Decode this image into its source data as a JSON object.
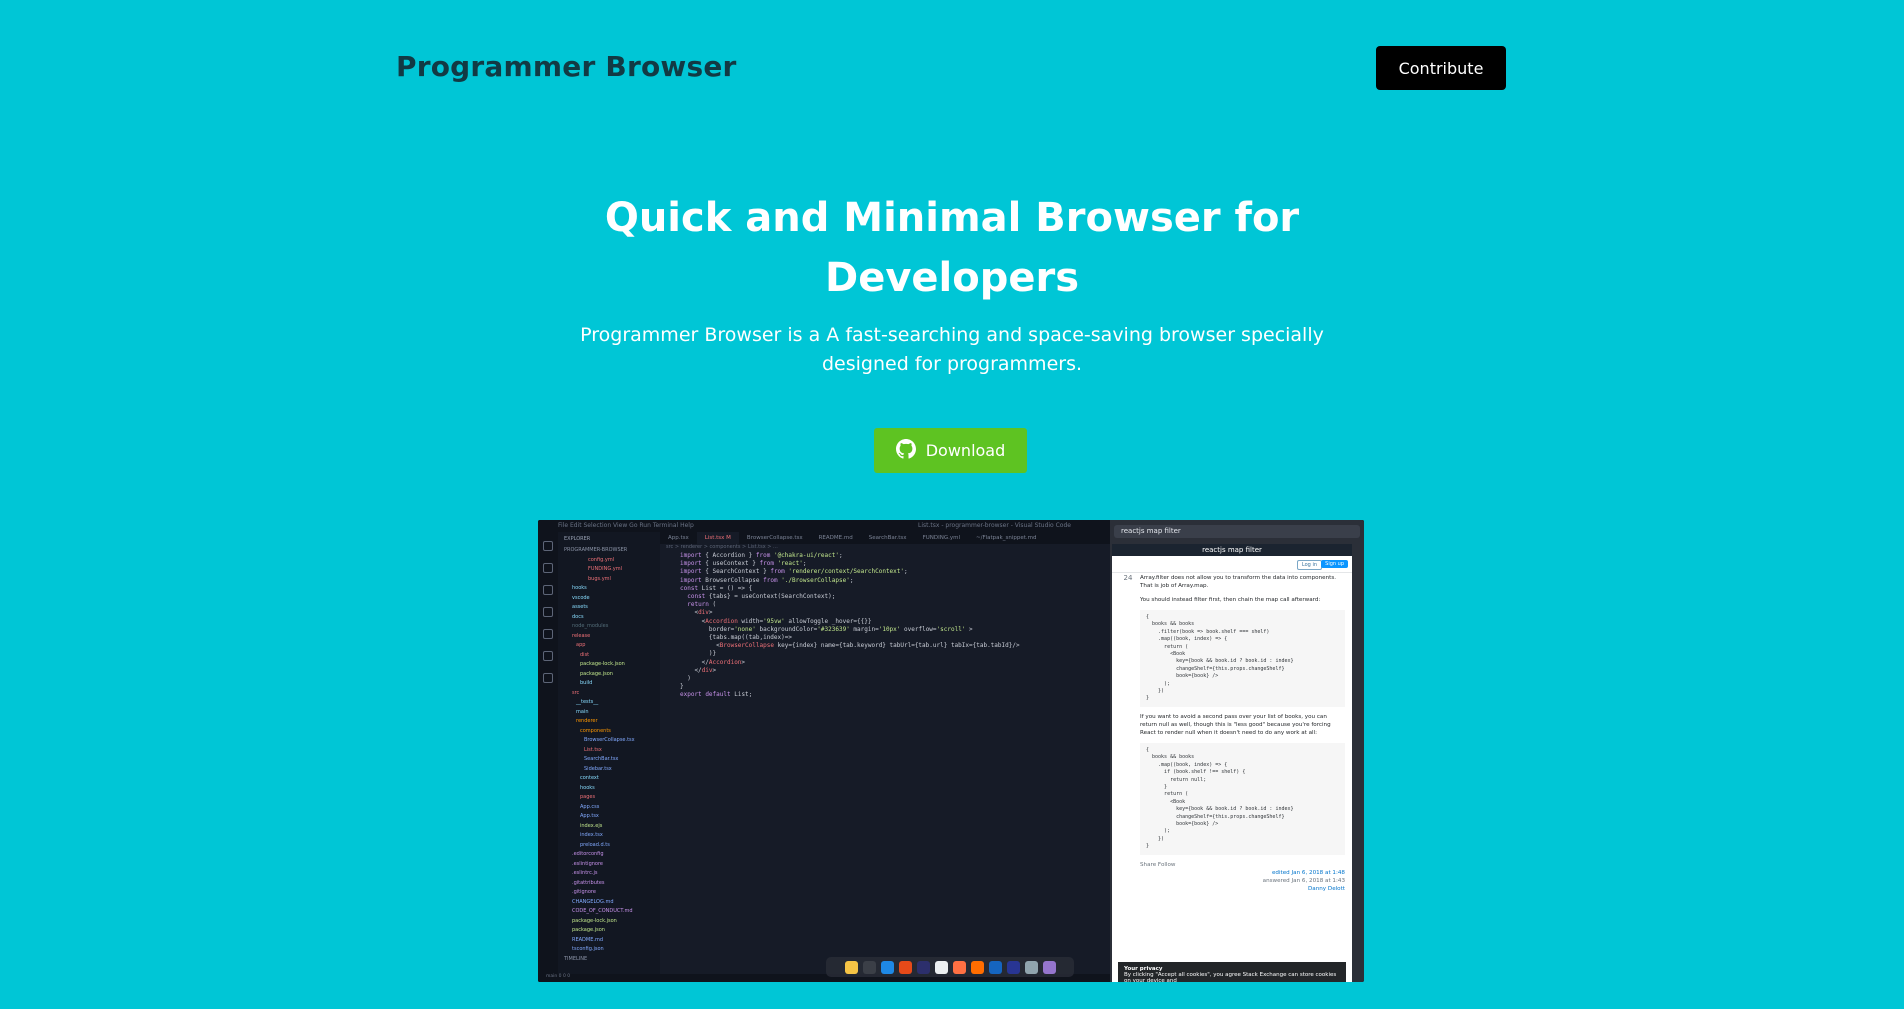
{
  "brand": "Programmer Browser",
  "contribute_label": "Contribute",
  "hero": {
    "title_line1": "Quick and Minimal Browser for",
    "title_line2": "Developers",
    "subtitle_line1": "Programmer Browser is a A fast-searching and space-saving browser specially",
    "subtitle_line2": "designed for programmers."
  },
  "download_label": "Download",
  "screenshot": {
    "window_title": "List.tsx - programmer-browser - Visual Studio Code",
    "menu": "File  Edit  Selection  View  Go  Run  Terminal  Help",
    "explorer_header": "EXPLORER",
    "project_name": "PROGRAMMER-BROWSER",
    "tree": [
      "config.yml",
      "FUNDING.yml",
      "bugs.yml",
      "hooks",
      "vscode",
      "assets",
      "docs",
      "node_modules",
      "release",
      "app",
      "dist",
      "package-lock.json",
      "package.json",
      "build",
      "src",
      "__tests__",
      "main",
      "renderer",
      "components",
      "BrowserCollapse.tsx",
      "List.tsx",
      "SearchBar.tsx",
      "Sidebar.tsx",
      "context",
      "hooks",
      "pages",
      "App.css",
      "App.tsx",
      "index.ejs",
      "index.tsx",
      "preload.d.ts",
      ".editorconfig",
      ".eslintignore",
      ".eslintrc.js",
      ".gitattributes",
      ".gitignore",
      "CHANGELOG.md",
      "CODE_OF_CONDUCT.md",
      "package-lock.json",
      "package.json",
      "README.md",
      "tsconfig.json"
    ],
    "tabs": [
      "App.tsx",
      "List.tsx M",
      "BrowserCollapse.tsx",
      "README.md",
      "SearchBar.tsx",
      "FUNDING.yml",
      "~/Flatpak_snippet.md"
    ],
    "breadcrumb": "src > renderer > components > List.tsx > ...",
    "code_lines": [
      "import { Accordion } from '@chakra-ui/react';",
      "import { useContext } from 'react';",
      "import { SearchContext } from 'renderer/context/SearchContext';",
      "import BrowserCollapse from './BrowserCollapse';",
      "",
      "const List = () => {",
      "",
      "  const {tabs} = useContext(SearchContext);",
      "",
      "  return (",
      "    <div>",
      "      <Accordion width='95vw' allowToggle _hover={{}}",
      "        border='none' backgroundColor='#323639' margin='10px' overflow='scroll' >",
      "        {tabs.map((tab,index)=>",
      "          <BrowserCollapse key={index} name={tab.keyword} tabUrl={tab.url} tabIx={tab.tabId}/>",
      "        )}",
      "      </Accordion>",
      "    </div>",
      "  )",
      "",
      "}",
      "",
      "",
      "export default List;"
    ],
    "status_text": "main  0 0 0",
    "timeline_label": "TIMELINE",
    "search_query": "reactjs map filter",
    "page_title": "reactjs map filter",
    "so": {
      "login": "Log in",
      "signup": "Sign up",
      "vote_count": "24",
      "para1": "Array.filter does not allow you to transform the data into components. That is job of Array.map.",
      "para2": "You should instead filter first, then chain the map call afterward:",
      "code1": "{\n  books && books\n    .filter(book => book.shelf === shelf)\n    .map((book, index) => {\n      return (\n        <Book\n          key={book && book.id ? book.id : index}\n          changeShelf={this.props.changeShelf}\n          book={book} />\n      );\n    })\n}",
      "para3": "If you want to avoid a second pass over your list of books, you can return null as well, though this is \"less good\" because you're forcing React to render null when it doesn't need to do any work at all:",
      "code2": "{\n  books && books\n    .map((book, index) => {\n      if (book.shelf !== shelf) {\n        return null;\n      }\n      return (\n        <Book\n          key={book && book.id ? book.id : index}\n          changeShelf={this.props.changeShelf}\n          book={book} />\n      );\n    })\n}",
      "share": "Share  Follow",
      "edited": "edited Jan 6, 2018 at 1:48",
      "answered": "answered Jan 6, 2018 at 1:43",
      "user": "Danny Delott",
      "privacy_title": "Your privacy",
      "privacy_text": "By clicking \"Accept all cookies\", you agree Stack Exchange can store cookies on your device and"
    }
  },
  "colors": {
    "background": "#00c6d6",
    "download": "#5ec322",
    "contribute": "#000000",
    "brand_text": "#123a44"
  }
}
